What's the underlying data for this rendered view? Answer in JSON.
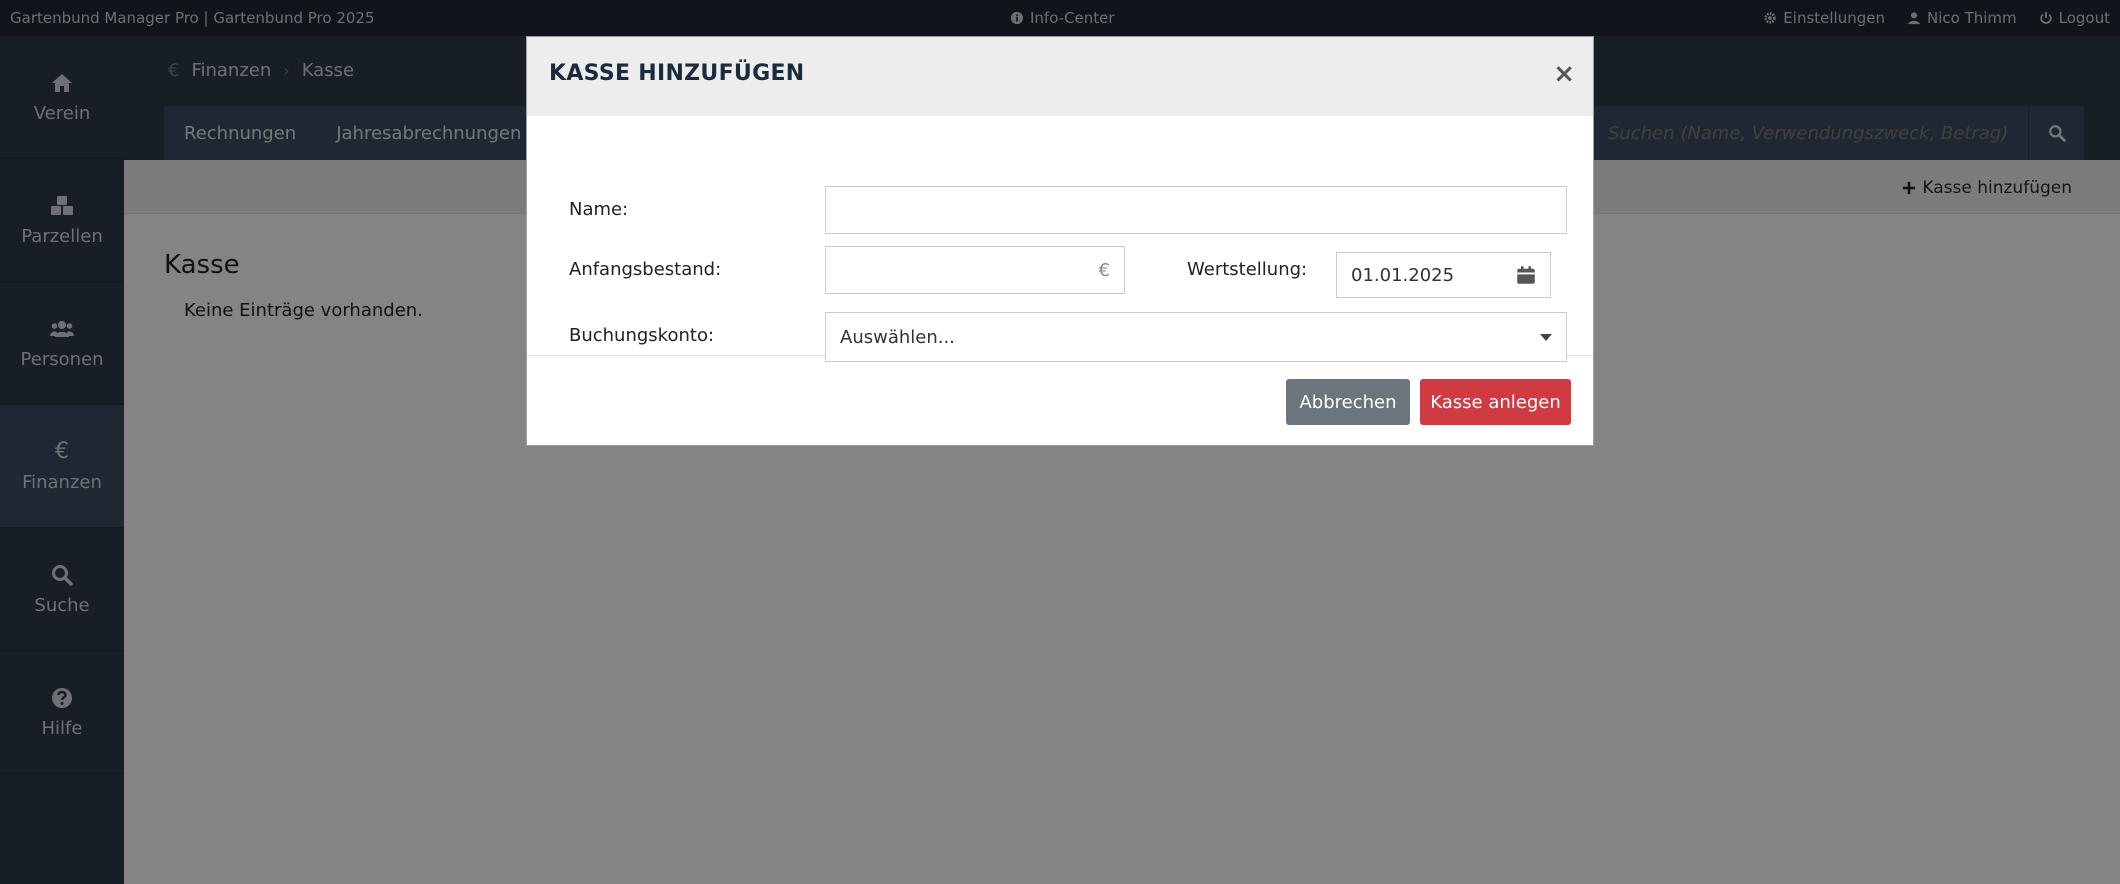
{
  "topbar": {
    "app_title": "Gartenbund Manager Pro | Gartenbund Pro 2025",
    "info_center": "Info-Center",
    "settings": "Einstellungen",
    "user": "Nico Thimm",
    "logout": "Logout"
  },
  "sidebar": {
    "items": [
      {
        "label": "Verein",
        "icon": "home-icon"
      },
      {
        "label": "Parzellen",
        "icon": "cubes-icon"
      },
      {
        "label": "Personen",
        "icon": "users-icon"
      },
      {
        "label": "Finanzen",
        "icon": "euro-icon",
        "active": true
      },
      {
        "label": "Suche",
        "icon": "search-icon"
      },
      {
        "label": "Hilfe",
        "icon": "help-icon"
      }
    ]
  },
  "breadcrumb": {
    "icon_glyph": "€",
    "items": [
      "Finanzen",
      "Kasse"
    ]
  },
  "tabs": [
    "Rechnungen",
    "Jahresabrechnungen"
  ],
  "search": {
    "placeholder": "Suchen (Name, Verwendungszweck, Betrag)"
  },
  "toolbar": {
    "add_label": "Kasse hinzufügen"
  },
  "content": {
    "title": "Kasse",
    "empty_text": "Keine Einträge vorhanden."
  },
  "modal": {
    "title": "KASSE HINZUFÜGEN",
    "close_glyph": "×",
    "fields": {
      "name_label": "Name:",
      "name_value": "",
      "opening_label": "Anfangsbestand:",
      "opening_value": "",
      "currency": "€",
      "value_date_label": "Wertstellung:",
      "value_date": "01.01.2025",
      "account_label": "Buchungskonto:",
      "account_selected": "Auswählen..."
    },
    "cancel_label": "Abbrechen",
    "save_label": "Kasse anlegen"
  },
  "colors": {
    "primary_dark": "#1f2732",
    "sidebar": "#2c3845",
    "save_red": "#d03b42",
    "cancel_gray": "#6c757d"
  }
}
